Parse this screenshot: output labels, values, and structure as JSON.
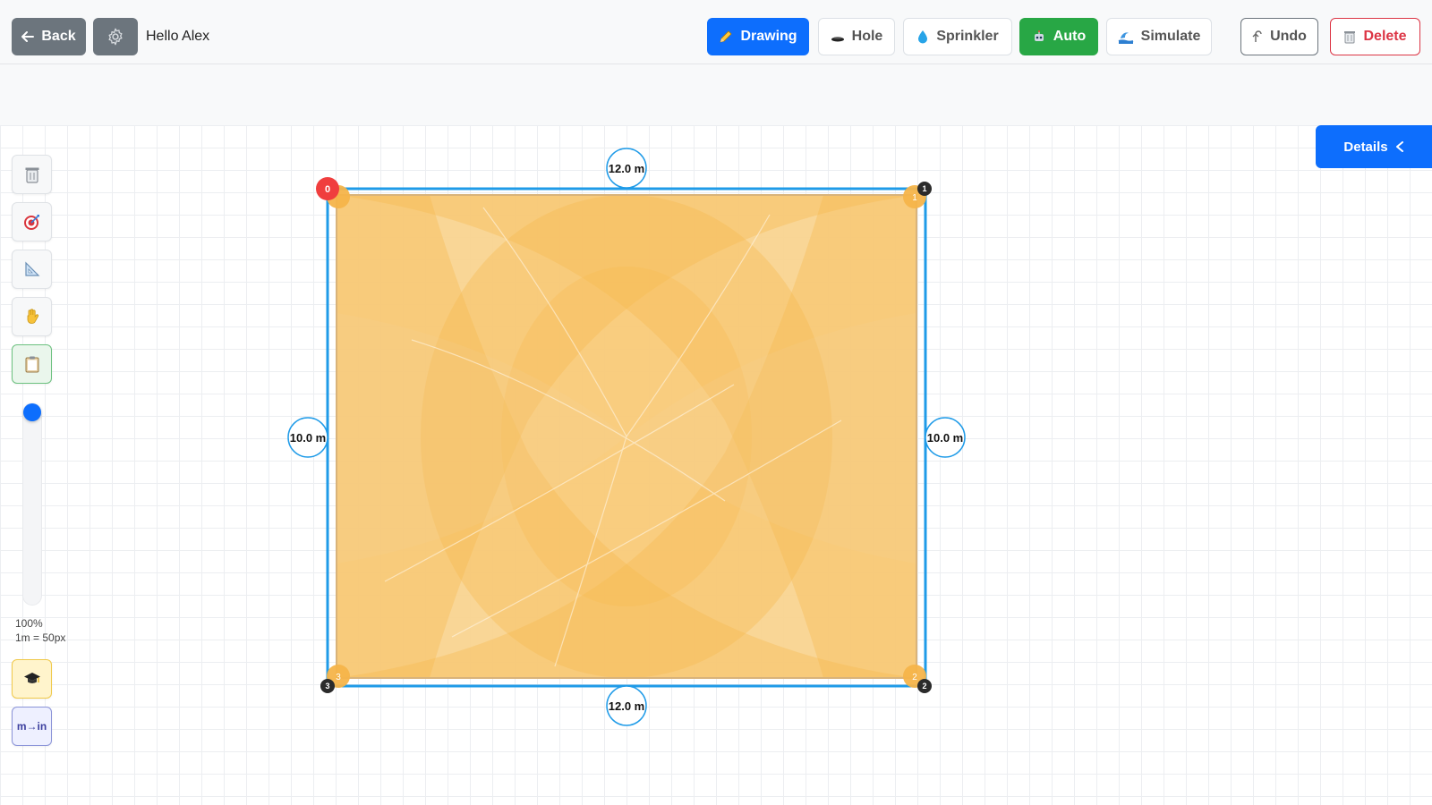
{
  "header": {
    "back_label": "Back",
    "greeting": "Hello Alex",
    "modes": {
      "drawing": "Drawing",
      "hole": "Hole",
      "sprinkler": "Sprinkler",
      "auto": "Auto",
      "simulate": "Simulate"
    },
    "undo_label": "Undo",
    "delete_label": "Delete"
  },
  "details_label": "Details",
  "toolbar": {
    "items": [
      {
        "name": "trash-tool",
        "icon": "trash-icon"
      },
      {
        "name": "target-tool",
        "icon": "target-icon"
      },
      {
        "name": "ruler-tool",
        "icon": "set-square-icon"
      },
      {
        "name": "pan-tool",
        "icon": "hand-icon"
      },
      {
        "name": "notes-tool",
        "icon": "clipboard-icon"
      }
    ],
    "zoom_percent": "100%",
    "scale": "1m = 50px",
    "learn_icon": "graduation-cap-icon",
    "units_toggle": "m→in"
  },
  "shape": {
    "top_length": "12.0 m",
    "bottom_length": "12.0 m",
    "left_length": "10.0 m",
    "right_length": "10.0 m",
    "vertex_labels": [
      "0",
      "1",
      "2",
      "3"
    ],
    "sprinkler_labels": [
      "",
      "1",
      "2",
      "3"
    ]
  },
  "colors": {
    "primary": "#0d6efd",
    "success": "#28a745",
    "danger": "#dc3545",
    "secondary": "#6c757d",
    "outline": "#1f9be8",
    "spray": "#f7b84b"
  }
}
